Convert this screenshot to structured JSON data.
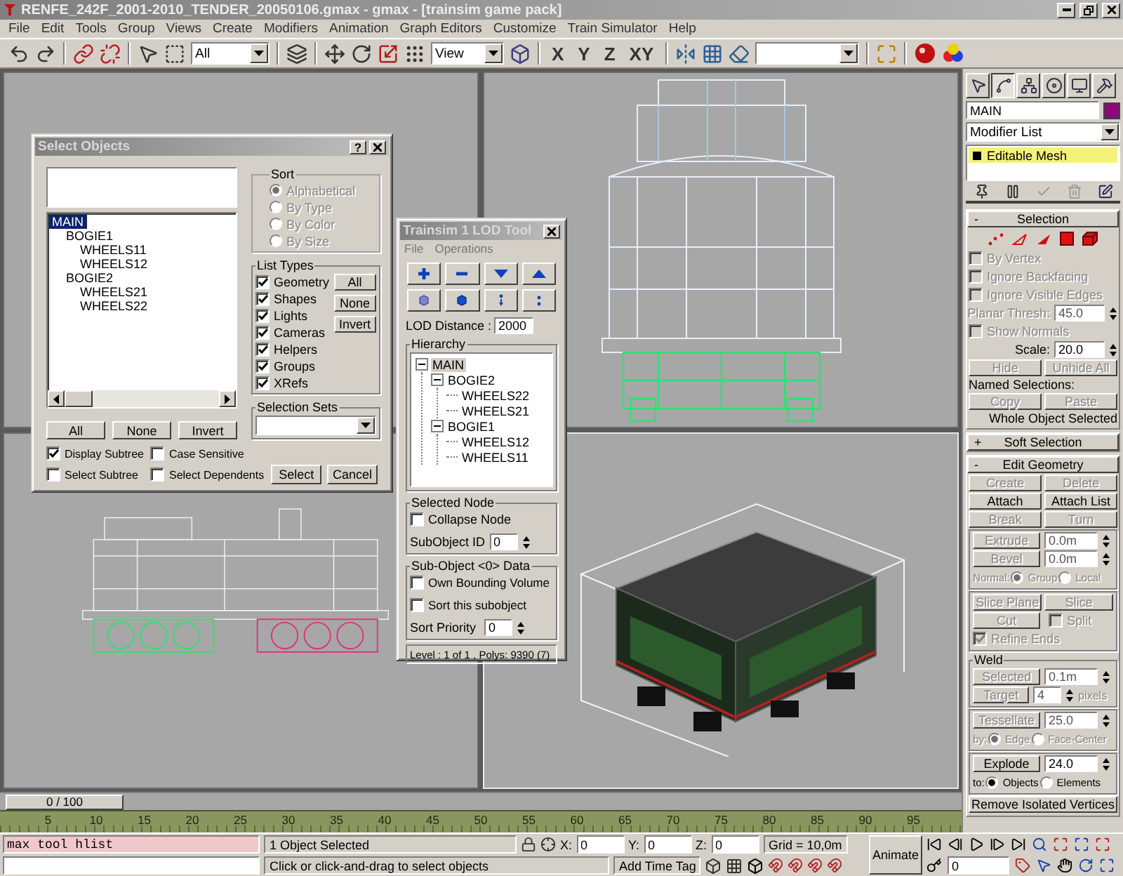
{
  "window": {
    "title": "RENFE_242F_2001-2010_TENDER_20050106.gmax - gmax - [trainsim game pack]"
  },
  "menu": [
    "File",
    "Edit",
    "Tools",
    "Group",
    "Views",
    "Create",
    "Modifiers",
    "Animation",
    "Graph Editors",
    "Customize",
    "Train Simulator",
    "Help"
  ],
  "toolbar": {
    "selection_filter": "All",
    "reference_coord": "View",
    "axis_buttons": [
      "X",
      "Y",
      "Z",
      "XY"
    ]
  },
  "select_objects": {
    "title": "Select Objects",
    "help": "?",
    "objects": [
      {
        "label": "MAIN",
        "selected": true,
        "children": [
          {
            "label": "BOGIE1",
            "selected": false,
            "children": [
              {
                "label": "WHEELS11",
                "selected": false
              },
              {
                "label": "WHEELS12",
                "selected": false
              }
            ]
          },
          {
            "label": "BOGIE2",
            "selected": false,
            "children": [
              {
                "label": "WHEELS21",
                "selected": false
              },
              {
                "label": "WHEELS22",
                "selected": false
              }
            ]
          }
        ]
      }
    ],
    "list_buttons": [
      "All",
      "None",
      "Invert"
    ],
    "options": [
      {
        "label": "Display Subtree",
        "checked": true
      },
      {
        "label": "Case Sensitive",
        "checked": false
      },
      {
        "label": "Select Subtree",
        "checked": false
      },
      {
        "label": "Select Dependents",
        "checked": false
      }
    ],
    "sort": {
      "title": "Sort",
      "disabled": true,
      "options": [
        {
          "label": "Alphabetical",
          "selected": true
        },
        {
          "label": "By Type",
          "selected": false
        },
        {
          "label": "By Color",
          "selected": false
        },
        {
          "label": "By Size",
          "selected": false
        }
      ]
    },
    "list_types": {
      "title": "List Types",
      "items": [
        {
          "label": "Geometry",
          "checked": true
        },
        {
          "label": "Shapes",
          "checked": true
        },
        {
          "label": "Lights",
          "checked": true
        },
        {
          "label": "Cameras",
          "checked": true
        },
        {
          "label": "Helpers",
          "checked": true
        },
        {
          "label": "Groups",
          "checked": true
        },
        {
          "label": "XRefs",
          "checked": true
        }
      ],
      "buttons": [
        "All",
        "None",
        "Invert"
      ]
    },
    "selection_sets": {
      "title": "Selection Sets"
    },
    "actions": [
      "Select",
      "Cancel"
    ]
  },
  "lod_tool": {
    "title": "Trainsim 1 LOD Tool",
    "menu": [
      "File",
      "Operations"
    ],
    "lod_distance": {
      "label": "LOD Distance :",
      "value": "2000"
    },
    "hierarchy": {
      "title": "Hierarchy",
      "tree": [
        {
          "label": "MAIN",
          "selected": true,
          "expanded": true,
          "children": [
            {
              "label": "BOGIE2",
              "selected": false,
              "expanded": true,
              "children": [
                {
                  "label": "WHEELS22",
                  "selected": false
                },
                {
                  "label": "WHEELS21",
                  "selected": false
                }
              ]
            },
            {
              "label": "BOGIE1",
              "selected": false,
              "expanded": true,
              "children": [
                {
                  "label": "WHEELS12",
                  "selected": false
                },
                {
                  "label": "WHEELS11",
                  "selected": false
                }
              ]
            }
          ]
        }
      ]
    },
    "selected_node": {
      "title": "Selected Node",
      "collapse": {
        "label": "Collapse Node",
        "checked": false
      },
      "subobject_id": {
        "label": "SubObject ID",
        "value": "0"
      }
    },
    "subobject_data": {
      "title": "Sub-Object <0> Data",
      "checks": [
        {
          "label": "Own Bounding Volume",
          "checked": false
        },
        {
          "label": "Sort this subobject",
          "checked": false
        }
      ],
      "sort_priority": {
        "label": "Sort Priority",
        "value": "0"
      }
    },
    "status": "Level : 1 of 1 , Polys: 9390 (7)"
  },
  "command_panel": {
    "tabs": [
      {
        "selected": false
      },
      {
        "selected": true
      },
      {
        "selected": false
      },
      {
        "selected": false
      },
      {
        "selected": false
      },
      {
        "selected": false
      }
    ],
    "object_name": "MAIN",
    "modifier_list": "Modifier List",
    "stack": [
      {
        "label": "Editable Mesh",
        "selected": true
      }
    ],
    "rollouts": [
      {
        "title": "Selection",
        "toggle": "-",
        "expanded": true,
        "rows": [
          {
            "kind": "subobject_icons"
          },
          {
            "kind": "check",
            "label": "By Vertex",
            "checked": false,
            "disabled": true
          },
          {
            "kind": "check",
            "label": "Ignore Backfacing",
            "checked": false,
            "disabled": true
          },
          {
            "kind": "check",
            "label": "Ignore Visible Edges",
            "checked": false,
            "disabled": true
          },
          {
            "kind": "spinner",
            "label": "Planar Thresh:",
            "value": "45.0",
            "disabled": true
          },
          {
            "kind": "check",
            "label": "Show Normals",
            "checked": false,
            "disabled": true
          },
          {
            "kind": "spinner",
            "label": "Scale:",
            "value": "20.0",
            "disabled": false
          },
          {
            "kind": "buttons",
            "buttons": [
              {
                "label": "Hide",
                "disabled": true
              },
              {
                "label": "Unhide All",
                "disabled": true
              }
            ]
          },
          {
            "kind": "heading",
            "text": "Named Selections:"
          },
          {
            "kind": "buttons",
            "buttons": [
              {
                "label": "Copy",
                "disabled": true
              },
              {
                "label": "Paste",
                "disabled": true
              }
            ]
          },
          {
            "kind": "note",
            "text": "Whole Object Selected"
          }
        ]
      },
      {
        "title": "Soft Selection",
        "toggle": "+",
        "expanded": false
      },
      {
        "title": "Edit Geometry",
        "toggle": "-",
        "expanded": true,
        "rows": [
          {
            "kind": "buttons",
            "buttons": [
              {
                "label": "Create",
                "disabled": true
              },
              {
                "label": "Delete",
                "disabled": true
              }
            ]
          },
          {
            "kind": "buttons",
            "buttons": [
              {
                "label": "Attach",
                "disabled": false
              },
              {
                "label": "Attach List",
                "disabled": false
              }
            ]
          },
          {
            "kind": "buttons",
            "buttons": [
              {
                "label": "Break",
                "disabled": true
              },
              {
                "label": "Turn",
                "disabled": true
              }
            ]
          },
          {
            "kind": "group",
            "rows": [
              {
                "kind": "button_spinner",
                "button": "Extrude",
                "value": "0.0m",
                "disabled": true
              },
              {
                "kind": "button_spinner",
                "button": "Bevel",
                "value": "0.0m",
                "disabled": true
              },
              {
                "kind": "radio",
                "label": "Normal:",
                "disabled": true,
                "options": [
                  {
                    "label": "Group",
                    "selected": true
                  },
                  {
                    "label": "Local",
                    "selected": false
                  }
                ]
              }
            ]
          },
          {
            "kind": "group",
            "rows": [
              {
                "kind": "buttons",
                "buttons": [
                  {
                    "label": "Slice Plane",
                    "disabled": true
                  },
                  {
                    "label": "Slice",
                    "disabled": true
                  }
                ]
              },
              {
                "kind": "button_check",
                "button": "Cut",
                "label": "Split",
                "checked": false,
                "disabled": true
              },
              {
                "kind": "check",
                "label": "Refine Ends",
                "checked": true,
                "disabled": true
              }
            ]
          },
          {
            "kind": "group",
            "title": "Weld",
            "rows": [
              {
                "kind": "button_spinner",
                "button": "Selected",
                "value": "0.1m",
                "disabled": true
              },
              {
                "kind": "button_spinner",
                "button": "Target",
                "value": "4",
                "suffix": "pixels",
                "disabled": true
              }
            ]
          },
          {
            "kind": "group",
            "rows": [
              {
                "kind": "button_spinner",
                "button": "Tessellate",
                "value": "25.0",
                "disabled": true
              },
              {
                "kind": "radio",
                "label": "by:",
                "disabled": true,
                "options": [
                  {
                    "label": "Edge",
                    "selected": true
                  },
                  {
                    "label": "Face-Center",
                    "selected": false
                  }
                ]
              }
            ]
          },
          {
            "kind": "group",
            "rows": [
              {
                "kind": "button_spinner",
                "button": "Explode",
                "value": "24.0",
                "disabled": false
              },
              {
                "kind": "radio",
                "label": "to:",
                "disabled": false,
                "options": [
                  {
                    "label": "Objects",
                    "selected": true
                  },
                  {
                    "label": "Elements",
                    "selected": false
                  }
                ]
              }
            ]
          },
          {
            "kind": "buttons",
            "buttons": [
              {
                "label": "Remove Isolated Vertices",
                "disabled": false
              }
            ]
          }
        ]
      }
    ]
  },
  "timeline": {
    "slider": "0 / 100",
    "level": 0,
    "ticks": [
      "5",
      "10",
      "15",
      "20",
      "25",
      "30",
      "35",
      "40",
      "45",
      "50",
      "55",
      "60",
      "65",
      "70",
      "75",
      "80",
      "85",
      "90",
      "95"
    ]
  },
  "status_bar": {
    "listener": "max tool hlist",
    "selection": "1 Object Selected",
    "prompt": "Click or click-and-drag to select objects",
    "coords": [
      {
        "label": "X:",
        "value": "0"
      },
      {
        "label": "Y:",
        "value": "0"
      },
      {
        "label": "Z:",
        "value": "0"
      }
    ],
    "grid": "Grid = 10,0m",
    "time_tag": "Add Time Tag",
    "animate": "Animate",
    "frame": "0"
  }
}
